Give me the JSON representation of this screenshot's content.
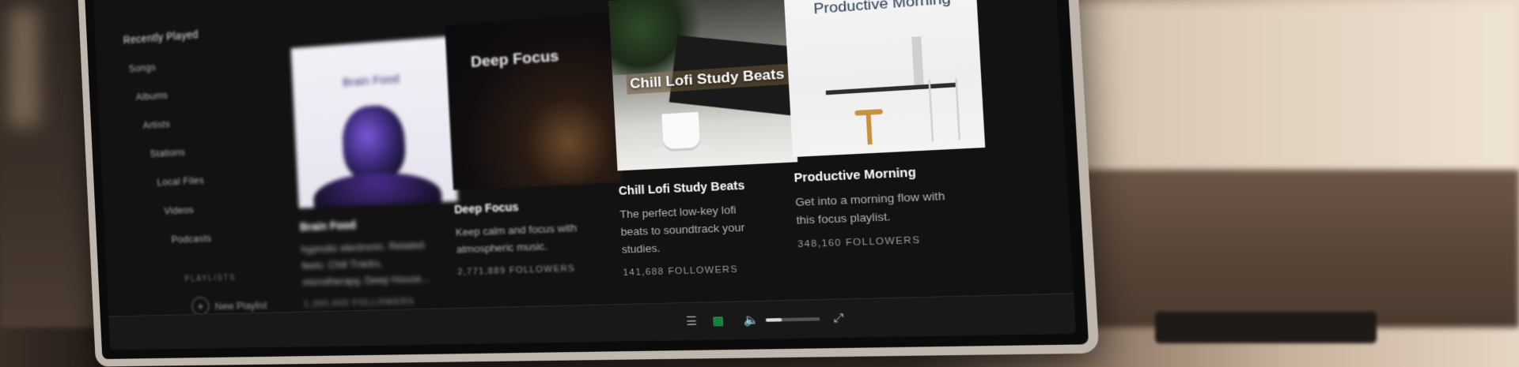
{
  "sidebar": {
    "items": [
      "Recently Played",
      "Songs",
      "Albums",
      "Artists",
      "Stations",
      "Local Files",
      "Videos",
      "Podcasts"
    ],
    "section_label": "PLAYLISTS",
    "new_playlist": "New Playlist"
  },
  "cards": [
    {
      "art_text": "Brain Food",
      "title": "Brain Food",
      "desc_lines": [
        "hypnotic electronic. Related",
        "feels: Chill Tracks,",
        "microtherapy, Deep House..."
      ],
      "followers": "1,260,000 FOLLOWERS"
    },
    {
      "art_text": "Deep Focus",
      "title": "Deep Focus",
      "desc_lines": [
        "Keep calm and focus with",
        "atmospheric music."
      ],
      "followers": "2,771,889 FOLLOWERS"
    },
    {
      "art_text": "Chill Lofi Study Beats",
      "title": "Chill Lofi Study Beats",
      "desc_lines": [
        "The perfect low-key lofi",
        "beats to soundtrack your",
        "studies."
      ],
      "followers": "141,688 FOLLOWERS"
    },
    {
      "art_text": "Productive Morning",
      "title": "Productive Morning",
      "desc_lines": [
        "Get into a morning flow with",
        "this focus playlist."
      ],
      "followers": "348,160 FOLLOWERS"
    }
  ],
  "player": {
    "icons": [
      "queue-icon",
      "devices-icon",
      "volume-icon",
      "fullscreen-icon"
    ],
    "volume_level": 0.3
  }
}
